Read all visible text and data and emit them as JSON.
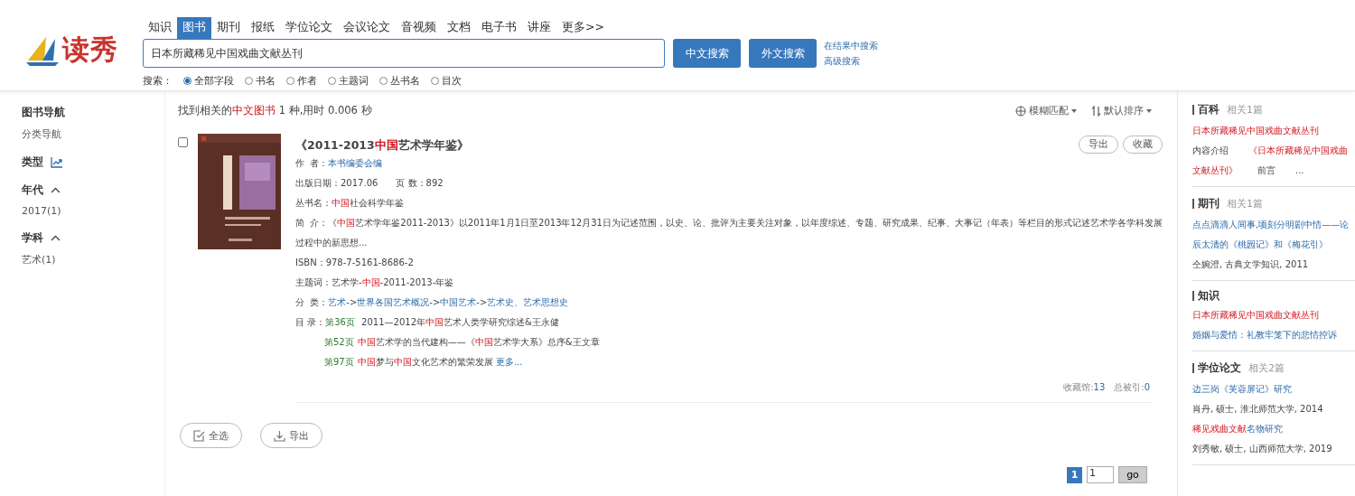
{
  "header": {
    "logo_text": "读秀",
    "tabs": [
      {
        "label": "知识",
        "selected": false
      },
      {
        "label": "图书",
        "selected": true
      },
      {
        "label": "期刊",
        "selected": false
      },
      {
        "label": "报纸",
        "selected": false
      },
      {
        "label": "学位论文",
        "selected": false
      },
      {
        "label": "会议论文",
        "selected": false
      },
      {
        "label": "音视频",
        "selected": false
      },
      {
        "label": "文档",
        "selected": false
      },
      {
        "label": "电子书",
        "selected": false
      },
      {
        "label": "讲座",
        "selected": false
      },
      {
        "label": "更多>>",
        "selected": false
      }
    ],
    "search": {
      "value": "日本所藏稀见中国戏曲文献丛刊",
      "buttons": [
        "中文搜索",
        "外文搜索"
      ],
      "links": [
        "在结果中搜索",
        "高级搜索"
      ]
    },
    "scope_label": "搜索：",
    "scopes": [
      {
        "label": "全部字段",
        "selected": true
      },
      {
        "label": "书名",
        "selected": false
      },
      {
        "label": "作者",
        "selected": false
      },
      {
        "label": "主题词",
        "selected": false
      },
      {
        "label": "丛书名",
        "selected": false
      },
      {
        "label": "目次",
        "selected": false
      }
    ]
  },
  "sidebar": {
    "title": "图书导航",
    "subtitle": "分类导航",
    "facets": [
      {
        "title": "类型",
        "kind": "chart"
      },
      {
        "title": "年代",
        "kind": "toggle",
        "expanded": true,
        "items": [
          "2017(1)"
        ]
      },
      {
        "title": "学科",
        "kind": "toggle",
        "expanded": true,
        "items": [
          "艺术(1)"
        ]
      }
    ]
  },
  "results": {
    "summary": [
      {
        "text": "找到相关的",
        "kind": "plain"
      },
      {
        "text": "中文图书",
        "kind": "hit"
      },
      {
        "text": " 1 种,用时 0.006 秒",
        "kind": "plain"
      }
    ],
    "sort": [
      "模糊匹配",
      "默认排序"
    ],
    "book": {
      "checked": false,
      "cover": {
        "kind": "picture"
      },
      "title": [
        {
          "text": "《2011-2013",
          "kind": "plain"
        },
        {
          "text": "中国",
          "kind": "hit"
        },
        {
          "text": "艺术学年鉴》",
          "kind": "plain"
        }
      ],
      "actions": [
        "导出",
        "收藏"
      ],
      "fields": [
        [
          {
            "text": "作  者：",
            "kind": "plain"
          },
          {
            "text": "本书编委会编",
            "kind": "link"
          }
        ],
        [
          {
            "text": "出版日期：2017.06",
            "kind": "plain"
          },
          {
            "text": "页  数：892",
            "kind": "plain"
          }
        ],
        [
          {
            "text": "丛书名：",
            "kind": "plain"
          },
          {
            "text": "中国",
            "kind": "hit"
          },
          {
            "text": "社会科学年鉴",
            "kind": "plain"
          }
        ],
        [
          {
            "text": "简  介：《",
            "kind": "plain"
          },
          {
            "text": "中国",
            "kind": "hit"
          },
          {
            "text": "艺术学年鉴2011-2013》以2011年1月1日至2013年12月31日为记述范围，以史、论、批评为主要关注对象，以年度综述、专题、研究成果、纪事、大事记（年表）等栏目的形式记述艺术学各学科发展过程中的新思想...",
            "kind": "plain"
          }
        ],
        [
          {
            "text": "ISBN：978-7-5161-8686-2",
            "kind": "plain"
          }
        ],
        [
          {
            "text": "主题词：艺术学-",
            "kind": "plain"
          },
          {
            "text": "中国",
            "kind": "hit"
          },
          {
            "text": "-2011-2013-年鉴",
            "kind": "plain"
          }
        ],
        [
          {
            "text": "分  类：",
            "kind": "plain"
          },
          {
            "text": "艺术",
            "kind": "link"
          },
          {
            "text": "->",
            "kind": "plain"
          },
          {
            "text": "世界各国艺术概况",
            "kind": "link"
          },
          {
            "text": "->",
            "kind": "plain"
          },
          {
            "text": "中国艺术",
            "kind": "link"
          },
          {
            "text": "->",
            "kind": "plain"
          },
          {
            "text": "艺术史、艺术思想史",
            "kind": "link"
          }
        ]
      ],
      "toc_label": "目  录：",
      "toc": [
        [
          {
            "text": "第36页",
            "kind": "page"
          },
          {
            "text": " 2011—2012年",
            "kind": "plain"
          },
          {
            "text": "中国",
            "kind": "hit"
          },
          {
            "text": "艺术人类学研究综述&王永健",
            "kind": "plain"
          }
        ],
        [
          {
            "text": "第52页",
            "kind": "page"
          },
          {
            "text": "中国",
            "kind": "hit"
          },
          {
            "text": "艺术学的当代建构——《",
            "kind": "plain"
          },
          {
            "text": "中国",
            "kind": "hit"
          },
          {
            "text": "艺术学大系》总序&王文章",
            "kind": "plain"
          }
        ],
        [
          {
            "text": "第97页",
            "kind": "page"
          },
          {
            "text": "中国",
            "kind": "hit"
          },
          {
            "text": "梦与",
            "kind": "plain"
          },
          {
            "text": "中国",
            "kind": "hit"
          },
          {
            "text": "文化艺术的繁荣发展 ",
            "kind": "plain"
          },
          {
            "text": "更多...",
            "kind": "link"
          }
        ]
      ],
      "stats": [
        {
          "label": "收藏馆:",
          "value": "13"
        },
        {
          "label": "总被引:",
          "value": "0"
        }
      ]
    },
    "bulk_actions": [
      "全选",
      "导出"
    ],
    "pagination": {
      "pages": [
        {
          "label": "1",
          "selected": true
        }
      ],
      "input": "1",
      "go": "go"
    }
  },
  "related": [
    {
      "title": "百科",
      "count": "相关1篇",
      "lines": [
        {
          "kind": "link",
          "segments": [
            {
              "text": "日本所藏稀见中国戏曲文献丛刊",
              "kind": "hit"
            }
          ]
        },
        {
          "kind": "snippet",
          "segments": [
            {
              "text": "内容介绍",
              "kind": "plain"
            },
            {
              "text": "《日本所藏稀见中国戏曲文献丛刊》",
              "kind": "hit"
            },
            {
              "text": "前言",
              "kind": "plain"
            },
            {
              "text": "...",
              "kind": "plain"
            }
          ]
        }
      ]
    },
    {
      "title": "期刊",
      "count": "相关1篇",
      "lines": [
        {
          "kind": "link",
          "segments": [
            {
              "text": "点点滴滴人间事,顷刻分明剧中情——论辰太清的《桃园记》和《梅花引》",
              "kind": "link"
            }
          ]
        },
        {
          "kind": "meta",
          "segments": [
            {
              "text": "仝婉澄, 古典文学知识, 2011",
              "kind": "plain"
            }
          ]
        }
      ]
    },
    {
      "title": "知识",
      "lines": [
        {
          "kind": "link",
          "segments": [
            {
              "text": "日本所藏稀见中国戏曲文献丛刊",
              "kind": "hit"
            }
          ]
        },
        {
          "kind": "link",
          "segments": [
            {
              "text": "婚姻与爱情：礼教牢笼下的悲情控诉",
              "kind": "link"
            }
          ]
        }
      ]
    },
    {
      "title": "学位论文",
      "count": "相关2篇",
      "lines": [
        {
          "kind": "link",
          "segments": [
            {
              "text": "边三岗《芙蓉屏记》研究",
              "kind": "link"
            }
          ]
        },
        {
          "kind": "meta",
          "segments": [
            {
              "text": "肖丹, 硕士, 淮北师范大学, 2014",
              "kind": "plain"
            }
          ]
        },
        {
          "kind": "link",
          "segments": [
            {
              "text": "稀见戏曲文献",
              "kind": "hit"
            },
            {
              "text": "名物研究",
              "kind": "link"
            }
          ]
        },
        {
          "kind": "meta",
          "segments": [
            {
              "text": "刘秀敏, 硕士, 山西师范大学, 2019",
              "kind": "plain"
            }
          ]
        }
      ]
    }
  ]
}
